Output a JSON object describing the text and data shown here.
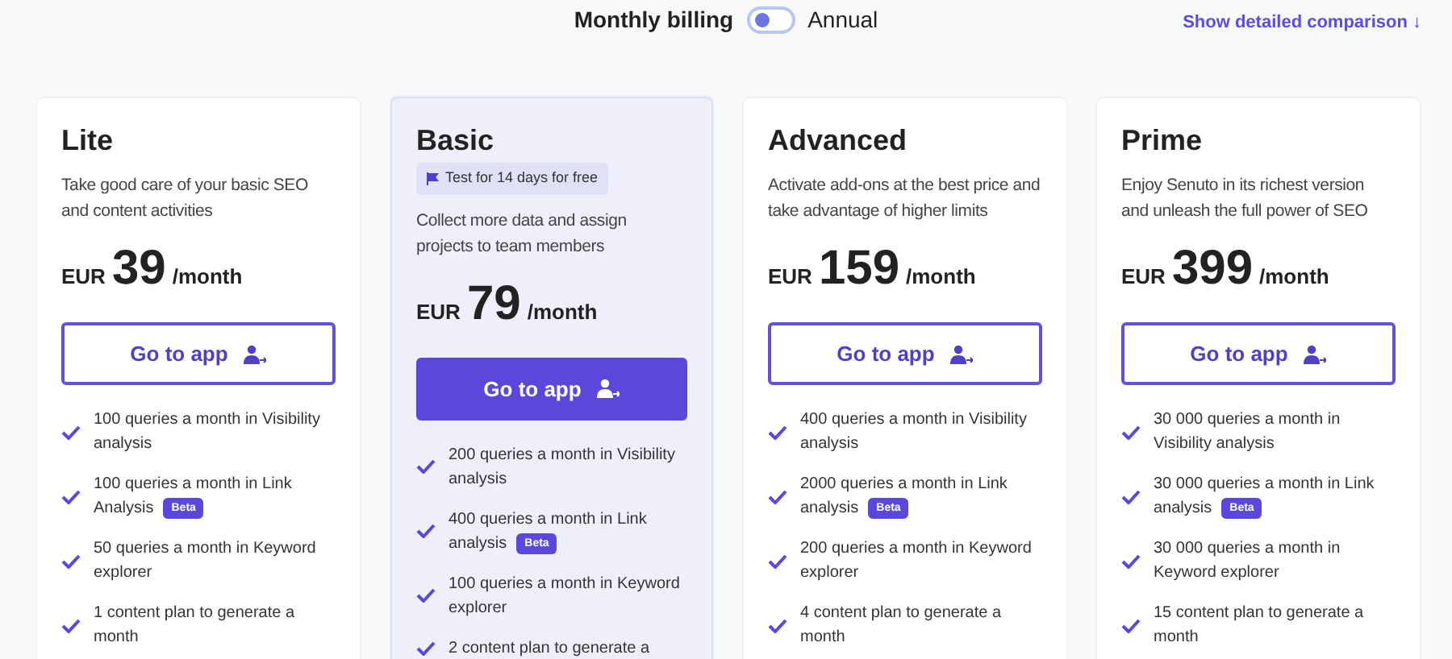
{
  "billing": {
    "monthly_label": "Monthly billing",
    "annual_label": "Annual",
    "annual": false
  },
  "comparison_link": "Show detailed comparison ↓",
  "plans": [
    {
      "name": "Lite",
      "featured": false,
      "description": "Take good care of your basic SEO and content activities",
      "currency": "EUR",
      "price": "39",
      "period": "/month",
      "button": "Go to app",
      "features": [
        {
          "text": "100 queries a month in Visibility analysis"
        },
        {
          "text": "100 queries a month in Link Analysis",
          "badge": "Beta"
        },
        {
          "text": "50 queries a month in Keyword explorer"
        },
        {
          "text": "1 content plan to generate a month"
        }
      ]
    },
    {
      "name": "Basic",
      "featured": true,
      "trial": "Test for 14 days for free",
      "description": "Collect more data and assign projects to team members",
      "currency": "EUR",
      "price": "79",
      "period": "/month",
      "button": "Go to app",
      "features": [
        {
          "text": "200 queries a month in Visibility analysis"
        },
        {
          "text": "400 queries a month in Link analysis",
          "badge": "Beta"
        },
        {
          "text": "100 queries a month in Keyword explorer"
        },
        {
          "text": "2 content plan to generate a"
        }
      ]
    },
    {
      "name": "Advanced",
      "featured": false,
      "description": "Activate add-ons at the best price and take advantage of higher limits",
      "currency": "EUR",
      "price": "159",
      "period": "/month",
      "button": "Go to app",
      "features": [
        {
          "text": "400 queries a month in Visibility analysis"
        },
        {
          "text": "2000 queries a month in Link analysis",
          "badge": "Beta"
        },
        {
          "text": "200 queries a month in Keyword explorer"
        },
        {
          "text": "4 content plan to generate a month"
        }
      ]
    },
    {
      "name": "Prime",
      "featured": false,
      "description": "Enjoy Senuto in its richest version and unleash the full power of SEO",
      "currency": "EUR",
      "price": "399",
      "period": "/month",
      "button": "Go to app",
      "features": [
        {
          "text": "30 000 queries a month in Visibility analysis"
        },
        {
          "text": "30 000 queries a month in Link analysis",
          "badge": "Beta"
        },
        {
          "text": "30 000 queries a month in Keyword explorer"
        },
        {
          "text": "15 content plan to generate a month"
        }
      ]
    }
  ]
}
